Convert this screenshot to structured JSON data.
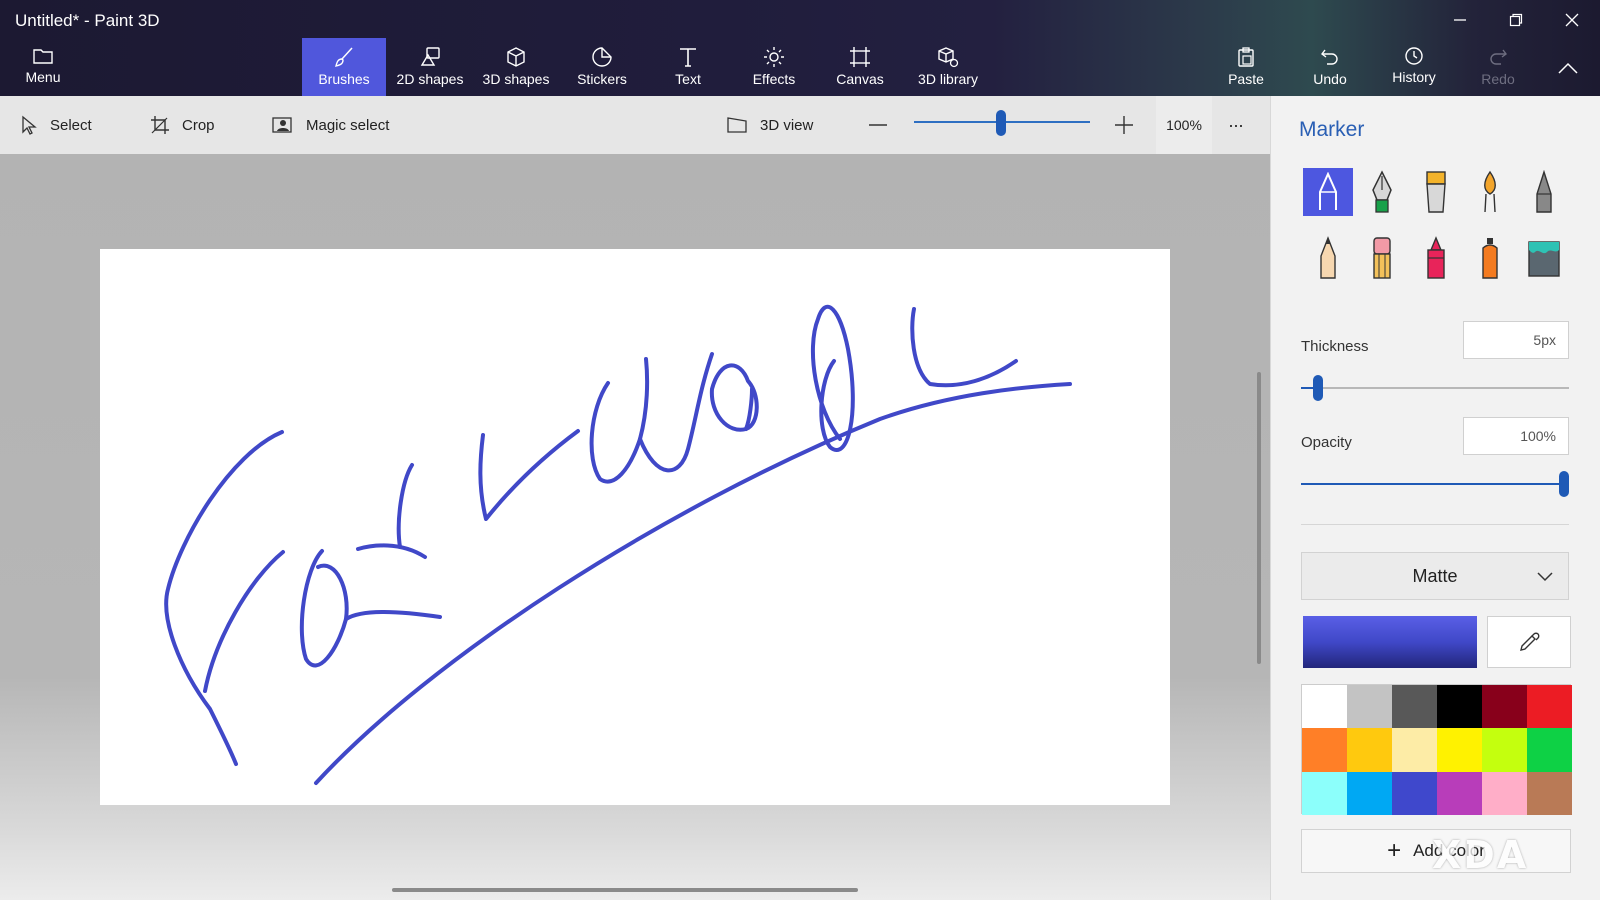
{
  "window": {
    "title": "Untitled* - Paint 3D",
    "controls": [
      "minimize-icon",
      "restore-icon",
      "close-icon"
    ]
  },
  "ribbon": {
    "menu": {
      "label": "Menu",
      "icon": "folder-icon"
    },
    "tools": [
      {
        "label": "Brushes",
        "icon": "brush-icon",
        "active": true
      },
      {
        "label": "2D shapes",
        "icon": "2d-shapes-icon"
      },
      {
        "label": "3D shapes",
        "icon": "cube-icon"
      },
      {
        "label": "Stickers",
        "icon": "sticker-icon"
      },
      {
        "label": "Text",
        "icon": "text-icon"
      },
      {
        "label": "Effects",
        "icon": "sun-icon"
      },
      {
        "label": "Canvas",
        "icon": "canvas-icon"
      },
      {
        "label": "3D library",
        "icon": "library-icon"
      }
    ],
    "actions": [
      {
        "label": "Paste",
        "icon": "clipboard-icon"
      },
      {
        "label": "Undo",
        "icon": "undo-icon"
      },
      {
        "label": "History",
        "icon": "history-icon"
      },
      {
        "label": "Redo",
        "icon": "redo-icon",
        "disabled": true
      }
    ]
  },
  "toolbar": {
    "select": "Select",
    "crop": "Crop",
    "magic_select": "Magic select",
    "view_3d": "3D view",
    "zoom_percent": "100%",
    "zoom_level": 0.5,
    "more": "···"
  },
  "panel": {
    "title": "Marker",
    "brushes": [
      "marker",
      "calligraphy-pen",
      "oil-brush",
      "watercolor",
      "pixel-pen",
      "pencil",
      "eraser",
      "crayon",
      "spray-can",
      "fill"
    ],
    "thickness": {
      "label": "Thickness",
      "value": "5px",
      "level": 0.05
    },
    "opacity": {
      "label": "Opacity",
      "value": "100%",
      "level": 1.0
    },
    "finish": "Matte",
    "current_color": "#4048c8",
    "palette": [
      "#ffffff",
      "#c3c3c3",
      "#585858",
      "#000000",
      "#88001b",
      "#ec1c24",
      "#ff7f27",
      "#ffc90e",
      "#fdeca6",
      "#fff200",
      "#c4ff0e",
      "#0ed145",
      "#8cfffb",
      "#00a8f3",
      "#3f48cc",
      "#b83dba",
      "#ffaec8",
      "#b97a56"
    ],
    "add_color": "Add color"
  },
  "drawing": {
    "stroke_color": "#4048c8"
  },
  "watermark": "XDA"
}
